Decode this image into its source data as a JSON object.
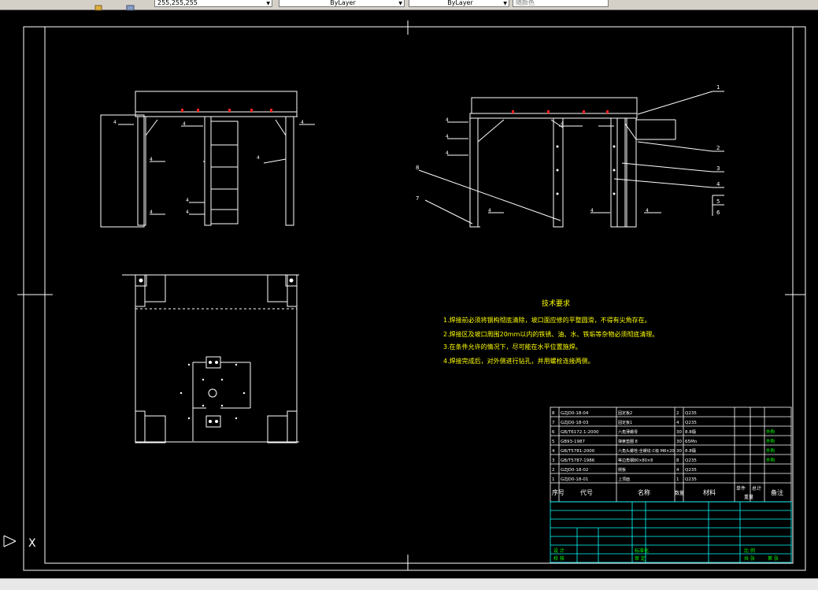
{
  "toolbar": {
    "color_value": "255,255,255",
    "linetype_value": "ByLayer",
    "lineweight_value": "ByLayer",
    "plotstyle_value": "随颜色"
  },
  "drawing": {
    "tech_title": "技术要求",
    "tech_notes": [
      "1.焊接前必须将钢构彻底清除，坡口面应修的平整圆滑，不得有尖角存在。",
      "2.焊接区及坡口周围20mm以内的铁锈、油、水、铁垢等杂物必须彻底清理。",
      "3.在条件允许的情况下，尽可能在水平位置施焊。",
      "4.焊接完成后，对外侧进行钻孔，并用螺栓连接两侧。"
    ],
    "callouts": [
      "1",
      "2",
      "3",
      "4",
      "5",
      "6",
      "7",
      "8"
    ],
    "weld_mark": "4",
    "bom_rows": [
      {
        "no": "8",
        "code": "GZJD0-18-04",
        "name": "固定板2",
        "qty": "2",
        "mat": "Q235"
      },
      {
        "no": "7",
        "code": "GZJD0-18-03",
        "name": "固定板1",
        "qty": "4",
        "mat": "Q235"
      },
      {
        "no": "6",
        "code": "GB/T6172.1-2000",
        "name": "六角薄螺母",
        "qty": "30",
        "mat": "8.8级",
        "note": "外购"
      },
      {
        "no": "5",
        "code": "GB93-1987",
        "name": "弹簧垫圈 8",
        "qty": "30",
        "mat": "65Mn",
        "note": "外购"
      },
      {
        "no": "4",
        "code": "GB/T5781-2000",
        "name": "六角头螺栓-全螺纹-C级 M8×20",
        "qty": "30",
        "mat": "8.8级",
        "note": "外购"
      },
      {
        "no": "3",
        "code": "GB/T5787-1986",
        "name": "等边角钢80×80×8",
        "qty": "8",
        "mat": "Q235",
        "note": "外购"
      },
      {
        "no": "2",
        "code": "GZJD0-18-02",
        "name": "侧板",
        "qty": "4",
        "mat": "Q235"
      },
      {
        "no": "1",
        "code": "GZJD0-18-01",
        "name": "上顶面",
        "qty": "1",
        "mat": "Q235"
      }
    ],
    "bom_header": {
      "no": "序号",
      "code": "代号",
      "name": "名称",
      "qty": "数量",
      "mat": "材料",
      "unit": "单件",
      "total": "总计",
      "weight": "重量",
      "note": "备注"
    },
    "title_block": {
      "r1": [
        "设 计",
        "",
        "标准化",
        ""
      ],
      "r2": [
        "校 核",
        "",
        "审 定",
        ""
      ],
      "scale_label": "比 例",
      "sheet_label": "共 张",
      "count": "第 张"
    },
    "ucs_label": "X"
  },
  "colors": {
    "line": "#ffffff",
    "border": "#ffffff",
    "accent_red": "#ff2020",
    "table_green": "#00ff00",
    "table_cyan": "#00ffff",
    "text_yellow": "#ffff00"
  }
}
